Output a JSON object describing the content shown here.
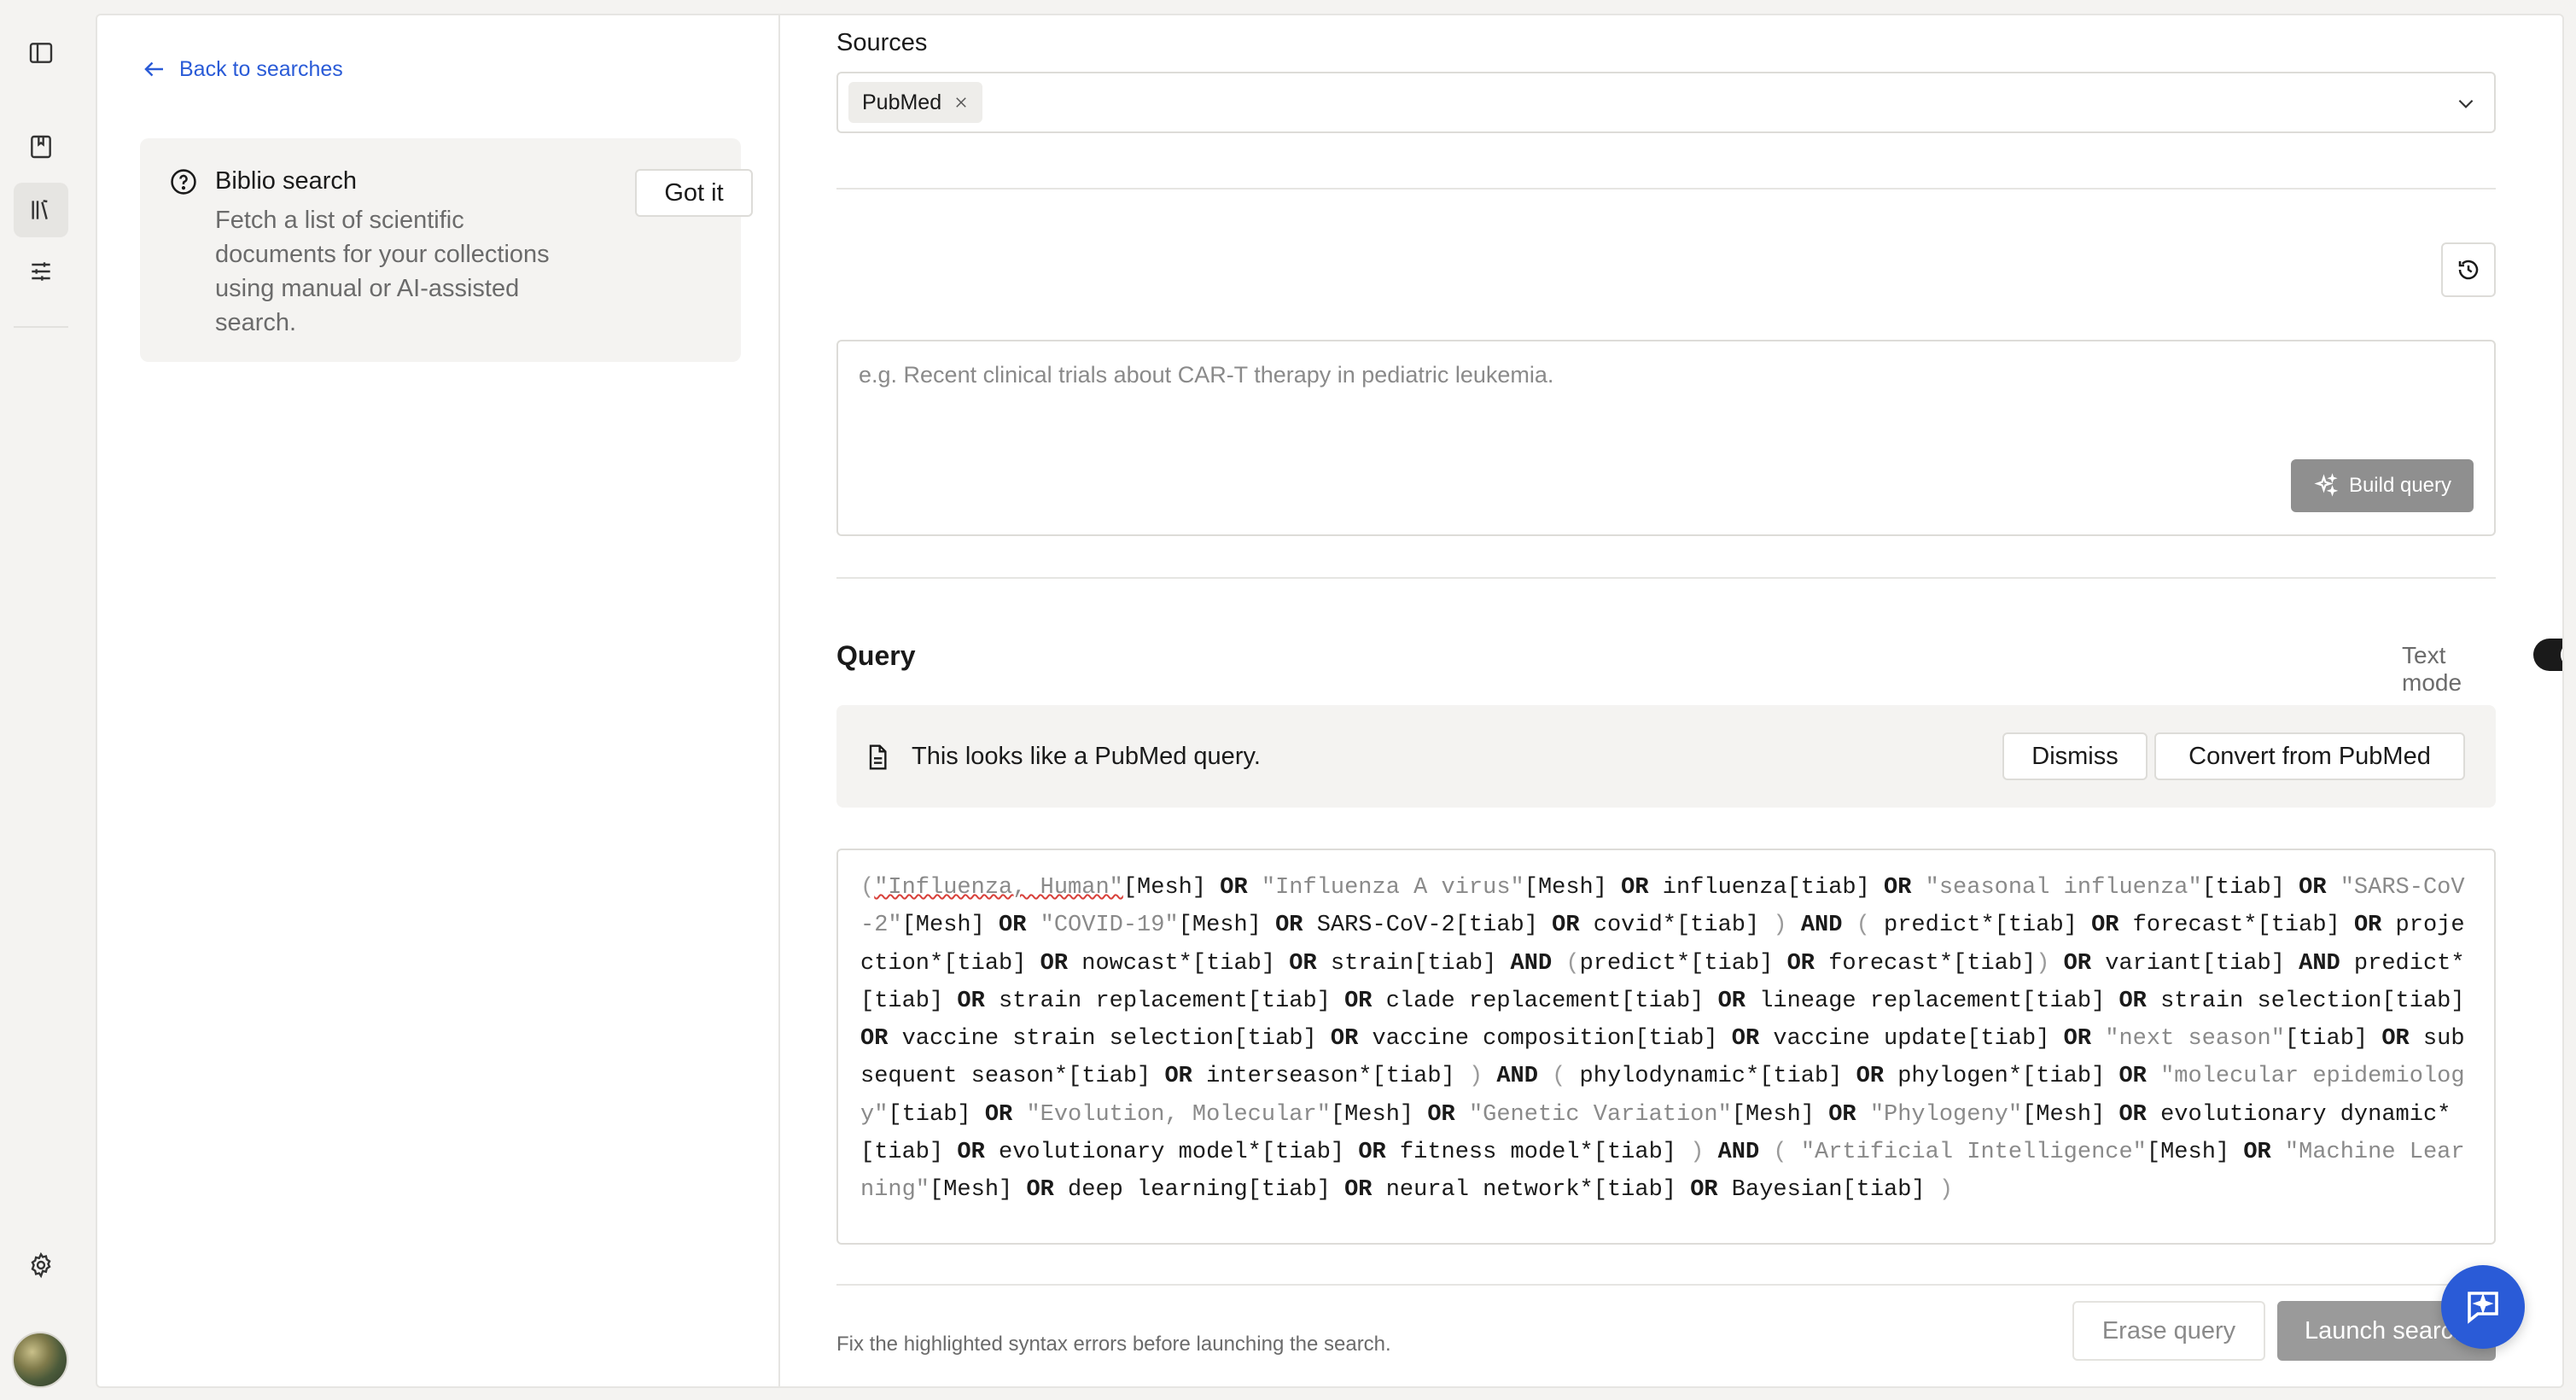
{
  "left_panel": {
    "back_link": "Back to searches",
    "info": {
      "title": "Biblio search",
      "description": "Fetch a list of scientific documents for your collections using manual or AI-assisted search.",
      "dismiss_label": "Got it"
    }
  },
  "sources": {
    "label": "Sources",
    "selected": [
      "PubMed"
    ]
  },
  "prompt": {
    "placeholder": "e.g. Recent clinical trials about CAR-T therapy in pediatric leukemia.",
    "build_label": "Build query"
  },
  "query": {
    "title": "Query",
    "text_mode_label": "Text mode",
    "text_mode_on": true,
    "banner": {
      "message": "This looks like a PubMed query.",
      "dismiss_label": "Dismiss",
      "convert_label": "Convert from PubMed"
    },
    "tokens": [
      {
        "t": "(",
        "k": "p"
      },
      {
        "t": "\"Influenza, Human\"",
        "k": "err"
      },
      {
        "t": "[Mesh] ",
        "k": "n"
      },
      {
        "t": "OR",
        "k": "op"
      },
      {
        "t": " ",
        "k": "n"
      },
      {
        "t": "\"Influenza A virus\"",
        "k": "str"
      },
      {
        "t": "[Mesh] ",
        "k": "n"
      },
      {
        "t": "OR",
        "k": "op"
      },
      {
        "t": " influenza[tiab] ",
        "k": "n"
      },
      {
        "t": "OR",
        "k": "op"
      },
      {
        "t": " ",
        "k": "n"
      },
      {
        "t": "\"seasonal influenza\"",
        "k": "str"
      },
      {
        "t": "[tiab] ",
        "k": "n"
      },
      {
        "t": "OR",
        "k": "op"
      },
      {
        "t": " ",
        "k": "n"
      },
      {
        "t": "\"SARS-CoV-2\"",
        "k": "str"
      },
      {
        "t": "[Mesh] ",
        "k": "n"
      },
      {
        "t": "OR",
        "k": "op"
      },
      {
        "t": " ",
        "k": "n"
      },
      {
        "t": "\"COVID-19\"",
        "k": "str"
      },
      {
        "t": "[Mesh] ",
        "k": "n"
      },
      {
        "t": "OR",
        "k": "op"
      },
      {
        "t": " SARS-CoV-2[tiab] ",
        "k": "n"
      },
      {
        "t": "OR",
        "k": "op"
      },
      {
        "t": " covid*[tiab] ",
        "k": "n"
      },
      {
        "t": ")",
        "k": "p"
      },
      {
        "t": " ",
        "k": "n"
      },
      {
        "t": "AND",
        "k": "op"
      },
      {
        "t": " ",
        "k": "n"
      },
      {
        "t": "(",
        "k": "p"
      },
      {
        "t": " predict*[tiab] ",
        "k": "n"
      },
      {
        "t": "OR",
        "k": "op"
      },
      {
        "t": " forecast*[tiab] ",
        "k": "n"
      },
      {
        "t": "OR",
        "k": "op"
      },
      {
        "t": " projection*[tiab] ",
        "k": "n"
      },
      {
        "t": "OR",
        "k": "op"
      },
      {
        "t": " nowcast*[tiab] ",
        "k": "n"
      },
      {
        "t": "OR",
        "k": "op"
      },
      {
        "t": " strain[tiab] ",
        "k": "n"
      },
      {
        "t": "AND",
        "k": "op"
      },
      {
        "t": " ",
        "k": "n"
      },
      {
        "t": "(",
        "k": "p"
      },
      {
        "t": "predict*[tiab] ",
        "k": "n"
      },
      {
        "t": "OR",
        "k": "op"
      },
      {
        "t": " forecast*[tiab]",
        "k": "n"
      },
      {
        "t": ")",
        "k": "p"
      },
      {
        "t": " ",
        "k": "n"
      },
      {
        "t": "OR",
        "k": "op"
      },
      {
        "t": " variant[tiab] ",
        "k": "n"
      },
      {
        "t": "AND",
        "k": "op"
      },
      {
        "t": " predict*[tiab] ",
        "k": "n"
      },
      {
        "t": "OR",
        "k": "op"
      },
      {
        "t": " strain replacement[tiab] ",
        "k": "n"
      },
      {
        "t": "OR",
        "k": "op"
      },
      {
        "t": " clade replacement[tiab] ",
        "k": "n"
      },
      {
        "t": "OR",
        "k": "op"
      },
      {
        "t": " lineage replacement[tiab] ",
        "k": "n"
      },
      {
        "t": "OR",
        "k": "op"
      },
      {
        "t": " strain selection[tiab] ",
        "k": "n"
      },
      {
        "t": "OR",
        "k": "op"
      },
      {
        "t": " vaccine strain selection[tiab] ",
        "k": "n"
      },
      {
        "t": "OR",
        "k": "op"
      },
      {
        "t": " vaccine composition[tiab] ",
        "k": "n"
      },
      {
        "t": "OR",
        "k": "op"
      },
      {
        "t": " vaccine update[tiab] ",
        "k": "n"
      },
      {
        "t": "OR",
        "k": "op"
      },
      {
        "t": " ",
        "k": "n"
      },
      {
        "t": "\"next season\"",
        "k": "str"
      },
      {
        "t": "[tiab] ",
        "k": "n"
      },
      {
        "t": "OR",
        "k": "op"
      },
      {
        "t": " subsequent season*[tiab] ",
        "k": "n"
      },
      {
        "t": "OR",
        "k": "op"
      },
      {
        "t": " interseason*[tiab] ",
        "k": "n"
      },
      {
        "t": ")",
        "k": "p"
      },
      {
        "t": " ",
        "k": "n"
      },
      {
        "t": "AND",
        "k": "op"
      },
      {
        "t": " ",
        "k": "n"
      },
      {
        "t": "(",
        "k": "p"
      },
      {
        "t": " phylodynamic*[tiab] ",
        "k": "n"
      },
      {
        "t": "OR",
        "k": "op"
      },
      {
        "t": " phylogen*[tiab] ",
        "k": "n"
      },
      {
        "t": "OR",
        "k": "op"
      },
      {
        "t": " ",
        "k": "n"
      },
      {
        "t": "\"molecular epidemiology\"",
        "k": "str"
      },
      {
        "t": "[tiab] ",
        "k": "n"
      },
      {
        "t": "OR",
        "k": "op"
      },
      {
        "t": " ",
        "k": "n"
      },
      {
        "t": "\"Evolution, Molecular\"",
        "k": "str"
      },
      {
        "t": "[Mesh] ",
        "k": "n"
      },
      {
        "t": "OR",
        "k": "op"
      },
      {
        "t": " ",
        "k": "n"
      },
      {
        "t": "\"Genetic Variation\"",
        "k": "str"
      },
      {
        "t": "[Mesh] ",
        "k": "n"
      },
      {
        "t": "OR",
        "k": "op"
      },
      {
        "t": " ",
        "k": "n"
      },
      {
        "t": "\"Phylogeny\"",
        "k": "str"
      },
      {
        "t": "[Mesh] ",
        "k": "n"
      },
      {
        "t": "OR",
        "k": "op"
      },
      {
        "t": " evolutionary dynamic*[tiab] ",
        "k": "n"
      },
      {
        "t": "OR",
        "k": "op"
      },
      {
        "t": " evolutionary model*[tiab] ",
        "k": "n"
      },
      {
        "t": "OR",
        "k": "op"
      },
      {
        "t": " fitness model*[tiab] ",
        "k": "n"
      },
      {
        "t": ")",
        "k": "p"
      },
      {
        "t": " ",
        "k": "n"
      },
      {
        "t": "AND",
        "k": "op"
      },
      {
        "t": " ",
        "k": "n"
      },
      {
        "t": "(",
        "k": "p"
      },
      {
        "t": " ",
        "k": "n"
      },
      {
        "t": "\"Artificial Intelligence\"",
        "k": "str"
      },
      {
        "t": "[Mesh] ",
        "k": "n"
      },
      {
        "t": "OR",
        "k": "op"
      },
      {
        "t": " ",
        "k": "n"
      },
      {
        "t": "\"Machine Learning\"",
        "k": "str"
      },
      {
        "t": "[Mesh] ",
        "k": "n"
      },
      {
        "t": "OR",
        "k": "op"
      },
      {
        "t": " deep learning[tiab] ",
        "k": "n"
      },
      {
        "t": "OR",
        "k": "op"
      },
      {
        "t": " neural network*[tiab] ",
        "k": "n"
      },
      {
        "t": "OR",
        "k": "op"
      },
      {
        "t": " Bayesian[tiab] ",
        "k": "n"
      },
      {
        "t": ")",
        "k": "p"
      }
    ]
  },
  "footer": {
    "message": "Fix the highlighted syntax errors before launching the search.",
    "erase_label": "Erase query",
    "launch_label": "Launch search"
  },
  "colors": {
    "accent": "#2a5bd7",
    "disabled_button": "#9a9a9a",
    "toggle_on": "#1a1a1a"
  }
}
